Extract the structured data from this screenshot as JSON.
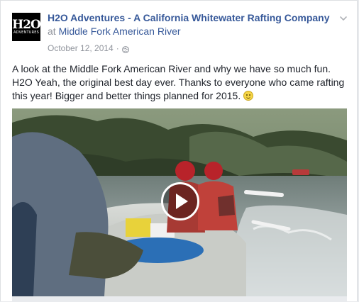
{
  "post": {
    "page_name": "H2O Adventures - A California Whitewater Rafting Company",
    "at_word": "at",
    "location": "Middle Fork American River",
    "date": "October 12, 2014",
    "date_separator": "·",
    "privacy_icon": "globe-icon",
    "options_icon": "chevron-down-icon",
    "message": "A look at the Middle Fork American River and why we have so much fun. H2O Yeah, the original best day ever. Thanks to everyone who came rafting this year! Bigger and better things planned for 2015.",
    "emoji": "smile-emoji-icon",
    "avatar": {
      "logo_main": "H2O",
      "logo_sub": "ADVENTURES"
    },
    "video": {
      "play_icon": "play-icon"
    }
  },
  "colors": {
    "link_blue": "#365899",
    "text": "#1d2129",
    "meta_gray": "#90949c"
  }
}
